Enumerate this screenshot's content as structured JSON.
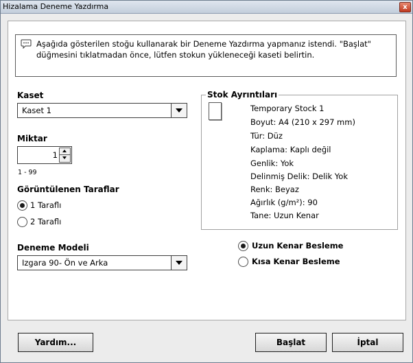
{
  "window": {
    "title": "Hizalama Deneme Yazdırma",
    "close_label": "x"
  },
  "message": {
    "text": "Aşağıda gösterilen stoğu kullanarak bir Deneme Yazdırma yapmanız istendi. \"Başlat\" düğmesini tıklatmadan önce, lütfen stokun yükleneceği kaseti belirtin."
  },
  "tray": {
    "label": "Kaset",
    "selected": "Kaset 1"
  },
  "quantity": {
    "label": "Miktar",
    "value": "1",
    "range": "1 - 99"
  },
  "sides": {
    "label": "Görüntülenen Taraflar",
    "options": [
      {
        "label": "1 Taraflı",
        "selected": true
      },
      {
        "label": "2 Taraflı",
        "selected": false
      }
    ]
  },
  "pattern": {
    "label": "Deneme Modeli",
    "selected": "Izgara 90- Ön ve Arka"
  },
  "stock": {
    "title": "Stok Ayrıntıları",
    "lines": [
      "Temporary Stock 1",
      "Boyut: A4 (210 x 297 mm)",
      "Tür: Düz",
      "Kaplama: Kaplı değil",
      "Genlik: Yok",
      "Delinmiş Delik: Delik Yok",
      "Renk: Beyaz",
      "Ağırlık (g/m²): 90",
      "Tane: Uzun Kenar"
    ]
  },
  "feed": {
    "options": [
      {
        "label": "Uzun Kenar Besleme",
        "selected": true
      },
      {
        "label": "Kısa Kenar Besleme",
        "selected": false
      }
    ]
  },
  "buttons": {
    "help": "Yardım...",
    "start": "Başlat",
    "cancel": "İptal"
  }
}
